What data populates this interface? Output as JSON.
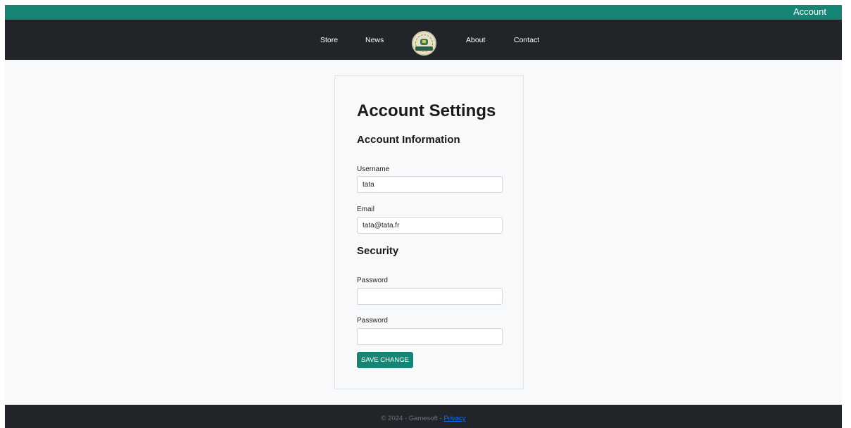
{
  "topbar": {
    "account_label": "Account"
  },
  "nav": {
    "items": [
      {
        "label": "Store"
      },
      {
        "label": "News"
      },
      {
        "label": "About"
      },
      {
        "label": "Contact"
      }
    ],
    "logo_icon": "gamesoft-logo-icon"
  },
  "form": {
    "title": "Account Settings",
    "account_section": "Account Information",
    "username_label": "Username",
    "username_value": "tata",
    "email_label": "Email",
    "email_value": "tata@tata.fr",
    "security_section": "Security",
    "password_label": "Password",
    "password_value": "",
    "password_confirm_label": "Password",
    "password_confirm_value": "",
    "save_label": "SAVE CHANGE"
  },
  "footer": {
    "text": "© 2024 - Gamesoft - ",
    "privacy_label": "Privacy"
  },
  "colors": {
    "accent": "#178573",
    "nav_bg": "#212529",
    "page_bg": "#f8f9fa",
    "link": "#0d6efd"
  }
}
